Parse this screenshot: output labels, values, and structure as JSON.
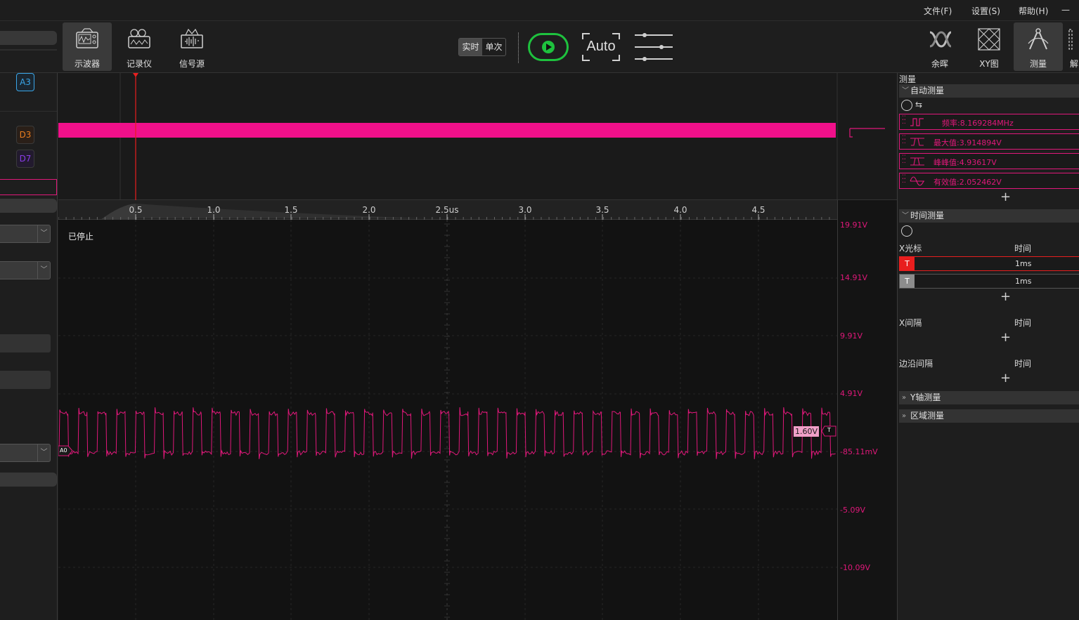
{
  "menu": {
    "file": "文件(F)",
    "settings": "设置(S)",
    "help": "帮助(H)",
    "minimize": "—"
  },
  "toolbar": {
    "left_tools": [
      {
        "label": "示波器",
        "icon": "oscilloscope-icon",
        "active": true
      },
      {
        "label": "记录仪",
        "icon": "recorder-icon",
        "active": false
      },
      {
        "label": "信号源",
        "icon": "signal-source-icon",
        "active": false
      }
    ],
    "mode": {
      "realtime": "实时",
      "single": "单次",
      "selected": "实时"
    },
    "auto_label": "Auto",
    "right_tools": [
      {
        "label": "余晖",
        "icon": "persistence-icon",
        "active": false
      },
      {
        "label": "XY图",
        "icon": "xy-plot-icon",
        "active": false
      },
      {
        "label": "测量",
        "icon": "measure-icon",
        "active": true
      },
      {
        "label": "解",
        "icon": "decode-icon",
        "active": false
      }
    ]
  },
  "left_panel": {
    "chips": [
      {
        "label": "A3",
        "color": "#3aa6e8"
      },
      {
        "label": "D3",
        "color": "#e87d1e"
      },
      {
        "label": "D7",
        "color": "#8a3ce8"
      }
    ]
  },
  "colors": {
    "accent": "#e0187a",
    "run": "#1ec23e",
    "cursor_red": "#e81e1e",
    "cursor_gray": "#8c8c8c"
  },
  "ruler": {
    "ticks": [
      "0.5",
      "1.0",
      "1.5",
      "2.0",
      "2.5us",
      "3.0",
      "3.5",
      "4.0",
      "4.5"
    ]
  },
  "scope": {
    "status": "已停止",
    "channel_tag": "A0",
    "trigger_level": "1.60V",
    "trigger_tag": "T",
    "volt_labels": [
      "19.91V",
      "14.91V",
      "9.91V",
      "4.91V",
      "-85.11mV",
      "-5.09V",
      "-10.09V"
    ]
  },
  "right_panel": {
    "title": "测量",
    "auto_measure": {
      "header": "自动测量",
      "items": [
        {
          "name": "频率",
          "value": "8.169284MHz",
          "text": "频率:8.169284MHz"
        },
        {
          "name": "最大值",
          "value": "3.914894V",
          "text": "最大值:3.914894V"
        },
        {
          "name": "峰峰值",
          "value": "4.93617V",
          "text": "峰峰值:4.93617V"
        },
        {
          "name": "有效值",
          "value": "2.052462V",
          "text": "有效值:2.052462V"
        }
      ]
    },
    "time_measure": {
      "header": "时间测量",
      "x_cursor_label": "X光标",
      "time_col": "时间",
      "cursors": [
        {
          "tag": "T",
          "value": "1ms"
        },
        {
          "tag": "T",
          "value": "1ms"
        }
      ],
      "x_interval_label": "X间隔",
      "edge_interval_label": "边沿间隔"
    },
    "y_measure_header": "Y轴测量",
    "region_measure_header": "区域测量"
  }
}
